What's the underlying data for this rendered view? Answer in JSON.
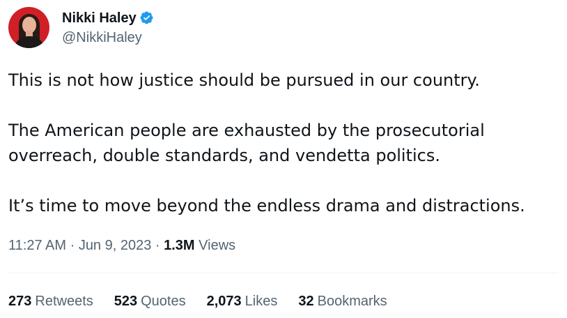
{
  "author": {
    "display_name": "Nikki Haley",
    "handle": "@NikkiHaley",
    "verified_color": "#1d9bf0"
  },
  "tweet": {
    "paragraphs": [
      "This is not how justice should be pursued in our country.",
      "The American people are exhausted by the prosecutorial overreach, double standards, and vendetta politics.",
      "It’s time to move beyond the endless drama and distractions."
    ],
    "time": "11:27 AM",
    "separator": " · ",
    "date": "Jun 9, 2023",
    "views_count": "1.3M",
    "views_label": "Views"
  },
  "stats": {
    "retweets": {
      "count": "273",
      "label": "Retweets"
    },
    "quotes": {
      "count": "523",
      "label": "Quotes"
    },
    "likes": {
      "count": "2,073",
      "label": "Likes"
    },
    "bookmarks": {
      "count": "32",
      "label": "Bookmarks"
    }
  },
  "icons": {
    "avatar": "profile-photo",
    "verified": "verified-badge-icon"
  }
}
